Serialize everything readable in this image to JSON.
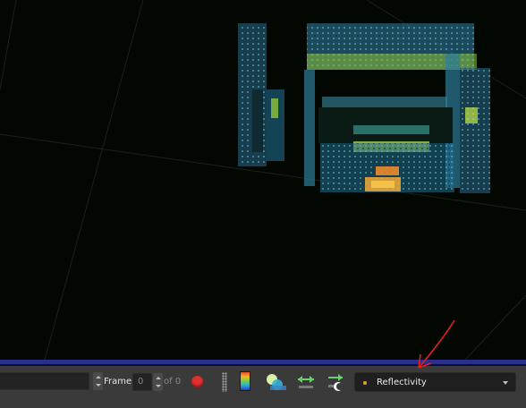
{
  "toolbar": {
    "search": {
      "value": "",
      "placeholder": ""
    },
    "frame_label": "Frame",
    "frame_value": "0",
    "of_label": "of 0",
    "color_mode_selected": "Reflectivity",
    "icons": {
      "record": "record-icon",
      "drag_handle": "drag-handle-icon",
      "color_bar": "colormap-icon",
      "point_size": "point-size-icon",
      "distance": "distance-icon",
      "range": "range-icon"
    }
  },
  "colors": {
    "viewport_bg": "#020702",
    "accent_bar": "#2b2f8c",
    "toolbar_bg": "#3a3a3a",
    "record": "#e03030",
    "annotation_arrow": "#e8201c"
  }
}
